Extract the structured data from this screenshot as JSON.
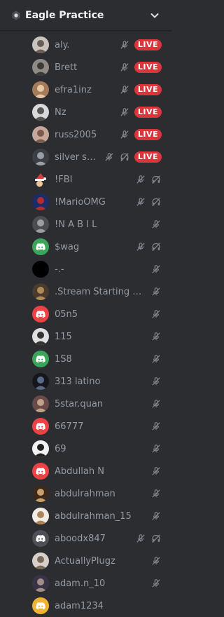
{
  "server": {
    "name": "Eagle Practice",
    "icon": "discovery-badge-icon"
  },
  "colors": {
    "background": "#2b2d31",
    "live_badge": "#da373c",
    "discord_red": "#ed4245",
    "discord_green": "#3ba55c",
    "discord_gray": "#4e5058",
    "text_muted": "#949ba4"
  },
  "participants": [
    {
      "name": "aly.",
      "muted": true,
      "deafened": false,
      "live": true,
      "live_label": "LIVE"
    },
    {
      "name": "Brett",
      "muted": true,
      "deafened": false,
      "live": true,
      "live_label": "LIVE"
    },
    {
      "name": "efra1inz",
      "muted": true,
      "deafened": false,
      "live": true,
      "live_label": "LIVE"
    },
    {
      "name": "Nz",
      "muted": true,
      "deafened": false,
      "live": true,
      "live_label": "LIVE"
    },
    {
      "name": "russ2005",
      "muted": true,
      "deafened": false,
      "live": true,
      "live_label": "LIVE"
    },
    {
      "name": "silver sp...",
      "muted": true,
      "deafened": true,
      "live": true,
      "live_label": "LIVE"
    },
    {
      "name": "!FBI",
      "muted": true,
      "deafened": true,
      "live": false
    },
    {
      "name": "!MarioOMG",
      "muted": true,
      "deafened": true,
      "live": false
    },
    {
      "name": "!N A B I L",
      "muted": true,
      "deafened": false,
      "live": false
    },
    {
      "name": "$wag",
      "muted": true,
      "deafened": true,
      "live": false
    },
    {
      "name": "-.-",
      "muted": true,
      "deafened": false,
      "live": false
    },
    {
      "name": ".Stream Starting So...",
      "muted": true,
      "deafened": false,
      "live": false
    },
    {
      "name": "05n5",
      "muted": true,
      "deafened": false,
      "live": false
    },
    {
      "name": "115",
      "muted": true,
      "deafened": false,
      "live": false
    },
    {
      "name": "1S8",
      "muted": true,
      "deafened": false,
      "live": false
    },
    {
      "name": "313 latino",
      "muted": true,
      "deafened": false,
      "live": false
    },
    {
      "name": "5star.quan",
      "muted": true,
      "deafened": false,
      "live": false
    },
    {
      "name": "66777",
      "muted": true,
      "deafened": false,
      "live": false
    },
    {
      "name": "69",
      "muted": true,
      "deafened": false,
      "live": false
    },
    {
      "name": "Abdullah N",
      "muted": true,
      "deafened": false,
      "live": false
    },
    {
      "name": "abdulrahman",
      "muted": true,
      "deafened": false,
      "live": false
    },
    {
      "name": "abdulrahman_15",
      "muted": true,
      "deafened": false,
      "live": false
    },
    {
      "name": "aboodx847",
      "muted": true,
      "deafened": true,
      "live": false
    },
    {
      "name": "ActuallyPlugz",
      "muted": true,
      "deafened": false,
      "live": false
    },
    {
      "name": "adam.n_10",
      "muted": true,
      "deafened": false,
      "live": false
    },
    {
      "name": "adam1234",
      "muted": false,
      "deafened": false,
      "live": false
    }
  ]
}
